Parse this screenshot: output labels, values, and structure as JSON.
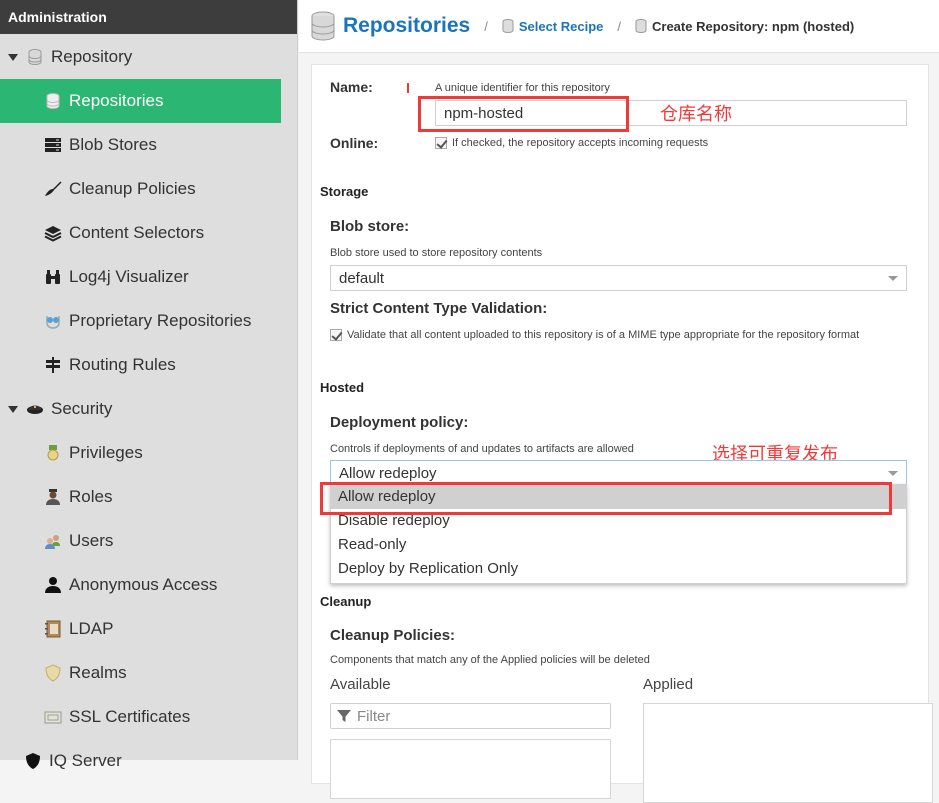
{
  "sidebar": {
    "header": "Administration",
    "items": [
      {
        "label": "Repository",
        "icon": "database-icon",
        "type": "group"
      },
      {
        "label": "Repositories",
        "icon": "database-icon",
        "type": "child",
        "active": true
      },
      {
        "label": "Blob Stores",
        "icon": "server-stack-icon",
        "type": "child"
      },
      {
        "label": "Cleanup Policies",
        "icon": "broom-icon",
        "type": "child"
      },
      {
        "label": "Content Selectors",
        "icon": "layers-icon",
        "type": "child"
      },
      {
        "label": "Log4j Visualizer",
        "icon": "binoculars-icon",
        "type": "child"
      },
      {
        "label": "Proprietary Repositories",
        "icon": "proprietary-icon",
        "type": "child"
      },
      {
        "label": "Routing Rules",
        "icon": "signpost-icon",
        "type": "child"
      },
      {
        "label": "Security",
        "icon": "police-cap-icon",
        "type": "group"
      },
      {
        "label": "Privileges",
        "icon": "medal-icon",
        "type": "child"
      },
      {
        "label": "Roles",
        "icon": "officer-icon",
        "type": "child"
      },
      {
        "label": "Users",
        "icon": "users-icon",
        "type": "child"
      },
      {
        "label": "Anonymous Access",
        "icon": "user-icon",
        "type": "child"
      },
      {
        "label": "LDAP",
        "icon": "address-book-icon",
        "type": "child"
      },
      {
        "label": "Realms",
        "icon": "shield-icon",
        "type": "child"
      },
      {
        "label": "SSL Certificates",
        "icon": "certificate-icon",
        "type": "child"
      },
      {
        "label": "IQ Server",
        "icon": "iq-shield-icon",
        "type": "group-partial"
      }
    ],
    "active_color": "#2bb673"
  },
  "breadcrumb": {
    "title": "Repositories",
    "separator": "/",
    "link": "Select Recipe",
    "current": "Create Repository: npm (hosted)"
  },
  "form": {
    "name": {
      "label": "Name:",
      "help": "A unique identifier for this repository",
      "value": "npm-hosted"
    },
    "online": {
      "label": "Online:",
      "checked": true,
      "help": "If checked, the repository accepts incoming requests"
    },
    "storage": {
      "section": "Storage",
      "blob_store_label": "Blob store:",
      "blob_store_help": "Blob store used to store repository contents",
      "blob_store_value": "default",
      "strict_label": "Strict Content Type Validation:",
      "strict_checked": true,
      "strict_help": "Validate that all content uploaded to this repository is of a MIME type appropriate for the repository format"
    },
    "hosted": {
      "section": "Hosted",
      "policy_label": "Deployment policy:",
      "policy_help": "Controls if deployments of and updates to artifacts are allowed",
      "policy_value": "Allow redeploy",
      "options": [
        "Allow redeploy",
        "Disable redeploy",
        "Read-only",
        "Deploy by Replication Only"
      ],
      "selected_index": 0
    },
    "cleanup": {
      "section": "Cleanup",
      "policies_label": "Cleanup Policies:",
      "policies_help": "Components that match any of the Applied policies will be deleted",
      "available_label": "Available",
      "applied_label": "Applied",
      "filter_placeholder": "Filter"
    }
  },
  "annotations": {
    "name_note": "仓库名称",
    "policy_note": "选择可重复发布",
    "color": "#f03a3a"
  }
}
